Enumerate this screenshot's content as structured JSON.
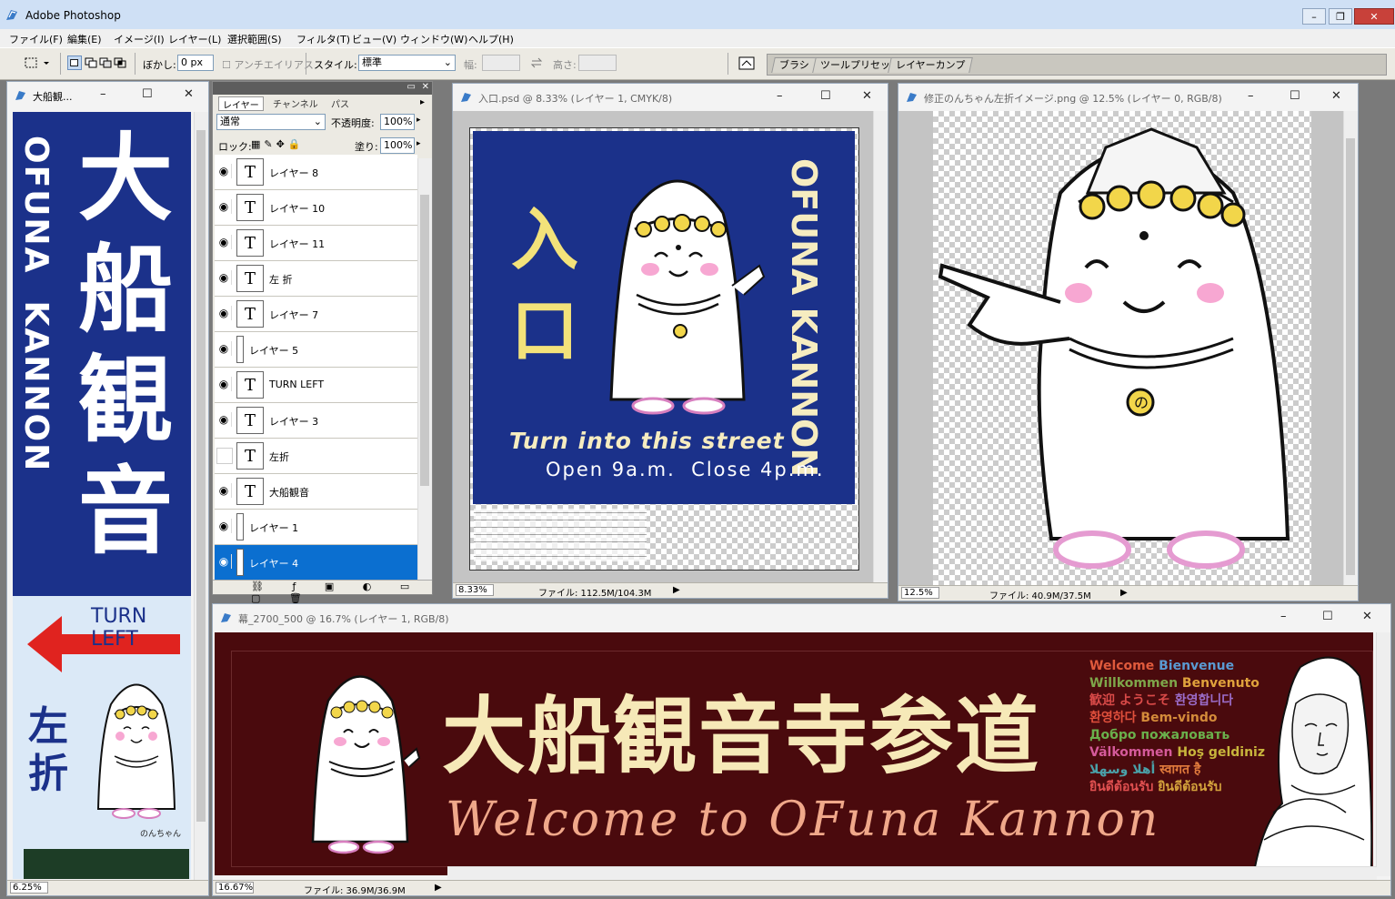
{
  "app": {
    "title": "Adobe Photoshop"
  },
  "window_controls": {
    "minimize": "–",
    "restore": "❐",
    "close": "✕"
  },
  "menu": [
    "ファイル(F)",
    "編集(E)",
    "イメージ(I)",
    "レイヤー(L)",
    "選択範囲(S)",
    "フィルタ(T)",
    "ビュー(V)",
    "ウィンドウ(W)",
    "ヘルプ(H)"
  ],
  "options_bar": {
    "feather_label": "ぼかし:",
    "feather_value": "0 px",
    "antialias_label": "アンチエイリアス",
    "style_label": "スタイル:",
    "style_value": "標準",
    "width_label": "幅:",
    "height_label": "高さ:",
    "dock_tabs": [
      "ブラシ",
      "ツールプリセット",
      "レイヤーカンプ"
    ]
  },
  "docs": {
    "sign": {
      "title": "大船観...",
      "zoom": "6.25%",
      "kanji": [
        "大",
        "船",
        "観",
        "音"
      ],
      "vertical_en": "OFUNA  KANNON",
      "turn_left": "TURN LEFT",
      "left_kanji": [
        "左",
        "折"
      ],
      "nonchan": "のんちゃん"
    },
    "entrance": {
      "title": "入口.psd @ 8.33% (レイヤー 1, CMYK/8)",
      "zoom": "8.33%",
      "file": "ファイル: 112.5M/104.3M",
      "kanji": [
        "入",
        "口"
      ],
      "vertical_en": "OFUNA KANNON",
      "line1": "Turn into this street",
      "line2": "Open 9a.m.  Close 4p.m."
    },
    "turn": {
      "title": "修正のんちゃん左折イメージ.png @ 12.5% (レイヤー 0, RGB/8)",
      "zoom": "12.5%",
      "file": "ファイル: 40.9M/37.5M",
      "mark": "の"
    },
    "banner": {
      "title": "幕_2700_500 @ 16.7% (レイヤー 1, RGB/8)",
      "zoom": "16.67%",
      "file": "ファイル: 36.9M/36.9M",
      "headline": "大船観音寺参道",
      "subline": "Welcome to OFuna Kannon",
      "greetings": [
        [
          {
            "t": "Welcome",
            "c": "#e05a3c"
          },
          {
            "t": " Bienvenue",
            "c": "#5a9ad2"
          }
        ],
        [
          {
            "t": "Willkommen",
            "c": "#7ea64a"
          },
          {
            "t": " Benvenuto",
            "c": "#e0a23c"
          }
        ],
        [
          {
            "t": "歓迎 ようこそ",
            "c": "#d94a48"
          },
          {
            "t": " 환영합니다",
            "c": "#9b6cc8"
          }
        ],
        [
          {
            "t": "환영하다",
            "c": "#e0503c"
          },
          {
            "t": " Bem-vindo",
            "c": "#d48b3a"
          }
        ],
        [
          {
            "t": "Добро пожаловать",
            "c": "#6ab04c"
          }
        ],
        [
          {
            "t": "Välkommen",
            "c": "#d45a9a"
          },
          {
            "t": " Hoş geldiniz",
            "c": "#c8b53c"
          }
        ],
        [
          {
            "t": "أهلا وسهلا",
            "c": "#4aa0a8"
          },
          {
            "t": " स्वागत है",
            "c": "#e07a3c"
          }
        ],
        [
          {
            "t": "ยินดีต้อนรับ",
            "c": "#e05050"
          },
          {
            "t": " ยินดีต้อนรับ",
            "c": "#d4a23c"
          }
        ]
      ]
    }
  },
  "layers_panel": {
    "tabs": [
      "レイヤー",
      "チャンネル",
      "パス"
    ],
    "blend_mode": "通常",
    "opacity_label": "不透明度:",
    "opacity_value": "100%",
    "lock_label": "ロック:",
    "fill_label": "塗り:",
    "fill_value": "100%",
    "layers": [
      {
        "name": "レイヤー 8",
        "type": "text",
        "visible": true,
        "selected": false
      },
      {
        "name": "レイヤー 10",
        "type": "text",
        "visible": true,
        "selected": false
      },
      {
        "name": "レイヤー 11",
        "type": "text",
        "visible": true,
        "selected": false
      },
      {
        "name": "左 折",
        "type": "text",
        "visible": true,
        "selected": false
      },
      {
        "name": "レイヤー 7",
        "type": "text",
        "visible": true,
        "selected": false
      },
      {
        "name": "レイヤー 5",
        "type": "pixel",
        "visible": true,
        "selected": false
      },
      {
        "name": "TURN LEFT",
        "type": "text",
        "visible": true,
        "selected": false
      },
      {
        "name": "レイヤー 3",
        "type": "text",
        "visible": true,
        "selected": false
      },
      {
        "name": "左折",
        "type": "text",
        "visible": false,
        "selected": false
      },
      {
        "name": "大船観音",
        "type": "text",
        "visible": true,
        "selected": false
      },
      {
        "name": "レイヤー 1",
        "type": "pixel",
        "visible": true,
        "selected": false
      },
      {
        "name": "レイヤー 4",
        "type": "pixel",
        "visible": true,
        "selected": true
      }
    ]
  },
  "colors": {
    "navy": "#1b318a",
    "sign_yellow": "#f3e27a",
    "banner_bg": "#4a0a0d",
    "banner_cream": "#f6e9b8",
    "banner_salmon": "#f0a88a",
    "arrow_red": "#e0231f",
    "select_blue": "#0b6fd0"
  }
}
